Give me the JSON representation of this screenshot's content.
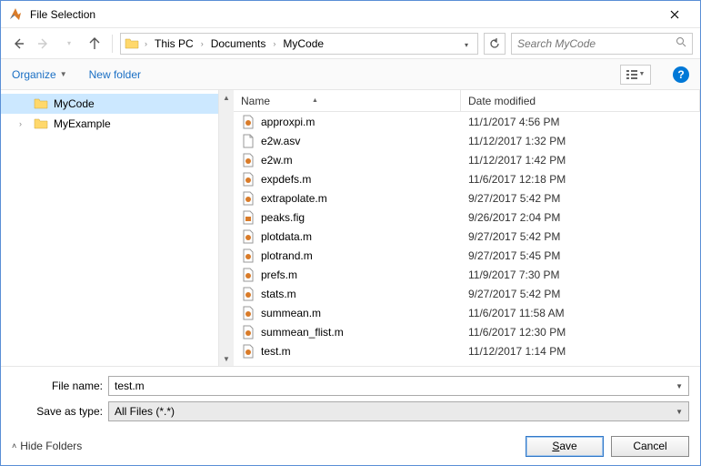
{
  "window": {
    "title": "File Selection"
  },
  "breadcrumb": {
    "items": [
      "This PC",
      "Documents",
      "MyCode"
    ]
  },
  "search": {
    "placeholder": "Search MyCode"
  },
  "toolbar": {
    "organize": "Organize",
    "newfolder": "New folder"
  },
  "tree": {
    "items": [
      {
        "label": "MyCode",
        "selected": true
      },
      {
        "label": "MyExample",
        "selected": false
      }
    ]
  },
  "columns": {
    "name": "Name",
    "date": "Date modified"
  },
  "files": [
    {
      "name": "approxpi.m",
      "date": "11/1/2017 4:56 PM",
      "icon": "m"
    },
    {
      "name": "e2w.asv",
      "date": "11/12/2017 1:32 PM",
      "icon": "asv"
    },
    {
      "name": "e2w.m",
      "date": "11/12/2017 1:42 PM",
      "icon": "m"
    },
    {
      "name": "expdefs.m",
      "date": "11/6/2017 12:18 PM",
      "icon": "m"
    },
    {
      "name": "extrapolate.m",
      "date": "9/27/2017 5:42 PM",
      "icon": "m"
    },
    {
      "name": "peaks.fig",
      "date": "9/26/2017 2:04 PM",
      "icon": "fig"
    },
    {
      "name": "plotdata.m",
      "date": "9/27/2017 5:42 PM",
      "icon": "m"
    },
    {
      "name": "plotrand.m",
      "date": "9/27/2017 5:45 PM",
      "icon": "m"
    },
    {
      "name": "prefs.m",
      "date": "11/9/2017 7:30 PM",
      "icon": "m"
    },
    {
      "name": "stats.m",
      "date": "9/27/2017 5:42 PM",
      "icon": "m"
    },
    {
      "name": "summean.m",
      "date": "11/6/2017 11:58 AM",
      "icon": "m"
    },
    {
      "name": "summean_flist.m",
      "date": "11/6/2017 12:30 PM",
      "icon": "m"
    },
    {
      "name": "test.m",
      "date": "11/12/2017 1:14 PM",
      "icon": "m"
    }
  ],
  "form": {
    "filename_label": "File name:",
    "filename_value": "test.m",
    "saveas_label": "Save as type:",
    "saveas_value": "All Files (*.*)"
  },
  "buttons": {
    "hide_folders": "Hide Folders",
    "save": "Save",
    "cancel": "Cancel"
  }
}
